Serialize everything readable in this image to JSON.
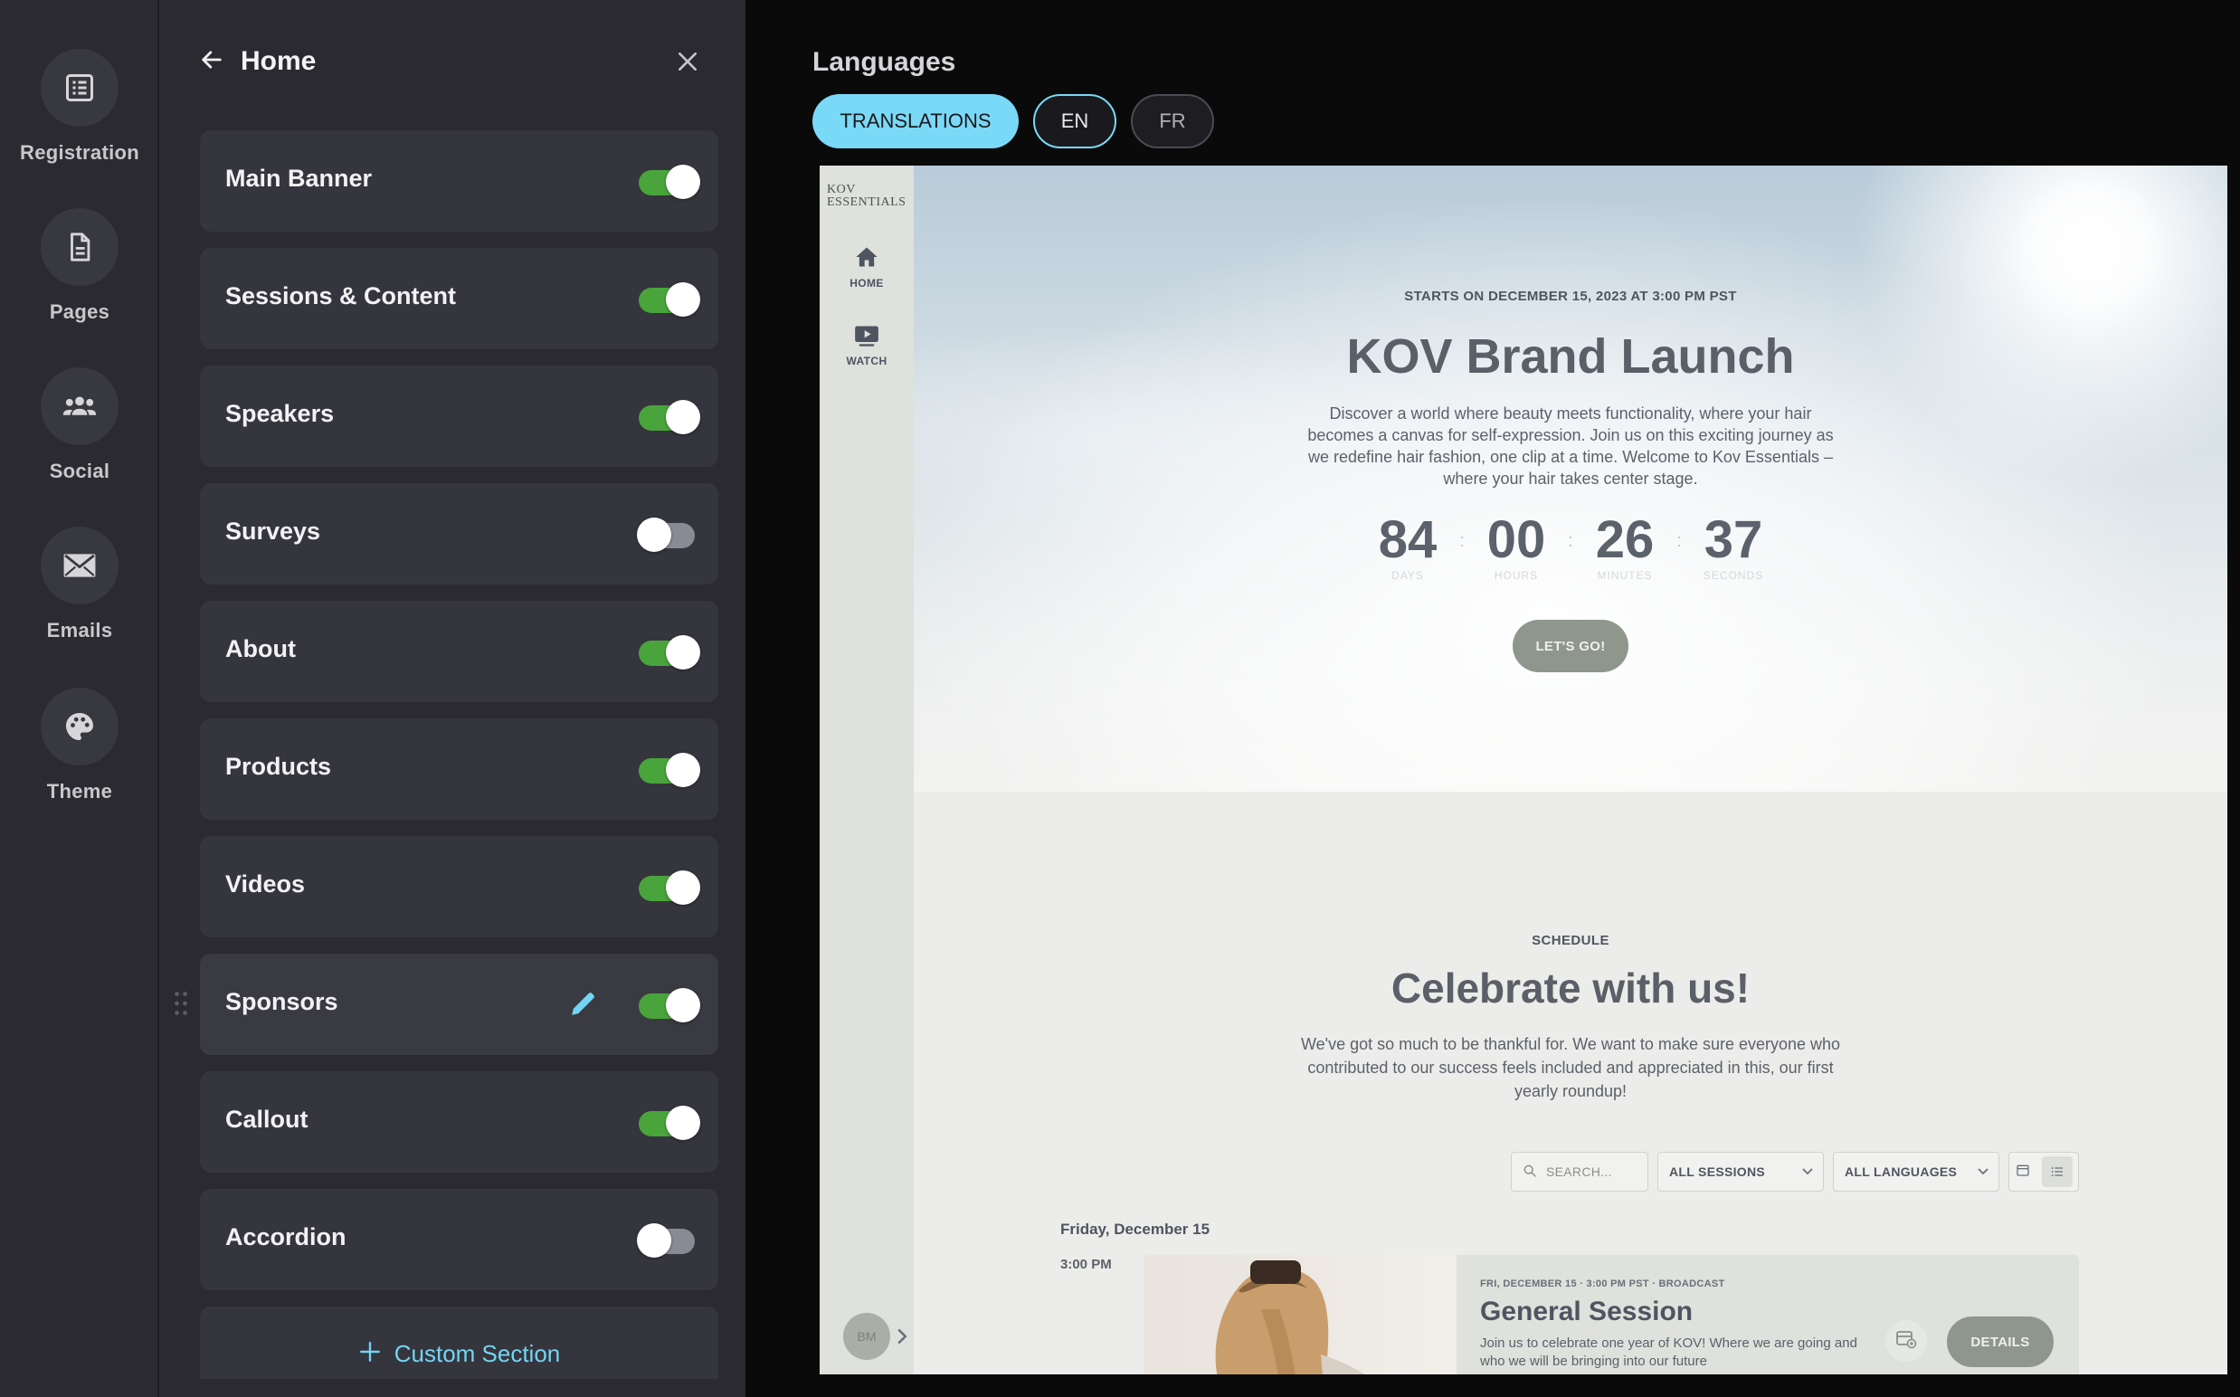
{
  "rail": {
    "items": [
      {
        "label": "Registration",
        "icon": "registration-list-icon"
      },
      {
        "label": "Pages",
        "icon": "page-document-icon"
      },
      {
        "label": "Social",
        "icon": "group-people-icon"
      },
      {
        "label": "Emails",
        "icon": "envelope-icon"
      },
      {
        "label": "Theme",
        "icon": "palette-icon"
      }
    ]
  },
  "panel": {
    "title": "Home",
    "sections": [
      {
        "label": "Main Banner",
        "enabled": true
      },
      {
        "label": "Sessions & Content",
        "enabled": true
      },
      {
        "label": "Speakers",
        "enabled": true
      },
      {
        "label": "Surveys",
        "enabled": false
      },
      {
        "label": "About",
        "enabled": true
      },
      {
        "label": "Products",
        "enabled": true
      },
      {
        "label": "Videos",
        "enabled": true
      },
      {
        "label": "Sponsors",
        "enabled": true
      },
      {
        "label": "Callout",
        "enabled": true
      },
      {
        "label": "Accordion",
        "enabled": false
      }
    ],
    "custom_section_label": "Custom Section"
  },
  "languages": {
    "title": "Languages",
    "translations_label": "TRANSLATIONS",
    "options": [
      "EN",
      "FR"
    ],
    "selected": "EN"
  },
  "preview": {
    "logo_line1": "KOV",
    "logo_line2": "ESSENTIALS",
    "nav": [
      {
        "label": "HOME",
        "icon": "home-icon"
      },
      {
        "label": "WATCH",
        "icon": "play-video-icon"
      }
    ],
    "avatar_initials": "BM",
    "hero": {
      "meta": "STARTS ON  DECEMBER 15, 2023 AT 3:00 PM PST",
      "title": "KOV Brand Launch",
      "description": "Discover a world where beauty meets functionality, where your hair becomes a canvas for self-expression. Join us on this exciting journey as we redefine hair fashion, one clip at a time. Welcome to Kov Essentials – where your hair takes center stage.",
      "countdown": {
        "days": "84",
        "hours": "00",
        "minutes": "26",
        "seconds": "37",
        "days_label": "DAYS",
        "hours_label": "HOURS",
        "minutes_label": "MINUTES",
        "seconds_label": "SECONDS"
      },
      "cta": "LET'S GO!"
    },
    "schedule": {
      "kicker": "SCHEDULE",
      "title": "Celebrate with us!",
      "description": "We've got so much to be thankful for. We want to make sure everyone who contributed to our success feels included and appreciated in this, our first yearly roundup!",
      "search_placeholder": "SEARCH...",
      "sessions_filter": "ALL SESSIONS",
      "languages_filter": "ALL LANGUAGES",
      "day": "Friday, December 15",
      "time": "3:00 PM",
      "session": {
        "meta": "FRI, DECEMBER 15 · 3:00 PM PST · BROADCAST",
        "title": "General Session",
        "description": "Join us to celebrate one year of KOV! Where we are going and who we will be bringing into our future",
        "details": "DETAILS"
      }
    }
  }
}
